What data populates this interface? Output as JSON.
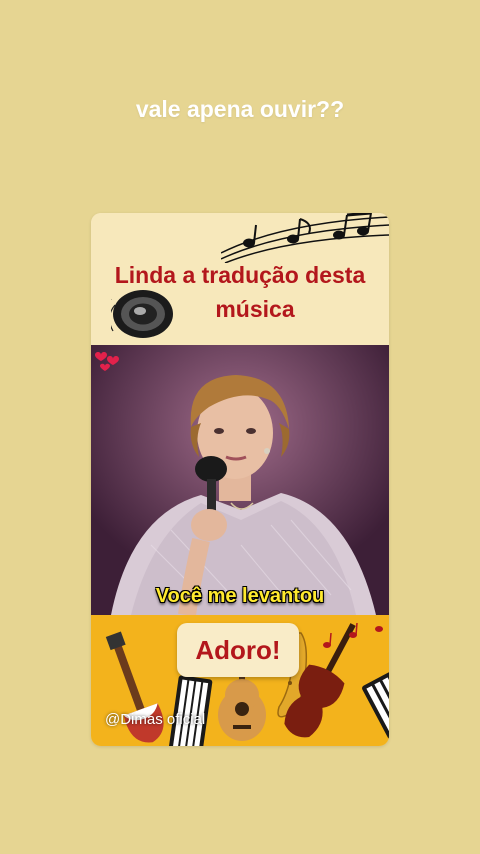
{
  "story": {
    "caption": "vale apena ouvir??"
  },
  "card": {
    "headline_line1": "Linda a tradução desta",
    "headline_line2": "música",
    "subtitle": "Você me levantou",
    "reaction_button": "Adoro!",
    "watermark": "@Dimas oficial"
  },
  "icons": {
    "speaker": "speaker-icon",
    "music_notes": "music-notes-icon",
    "hearts": "hearts-icon",
    "instruments": "instruments-illustration"
  },
  "colors": {
    "background": "#e6d592",
    "headline": "#b3171c",
    "subtitle": "#ffea2e",
    "bottom_panel": "#f3b31c"
  }
}
